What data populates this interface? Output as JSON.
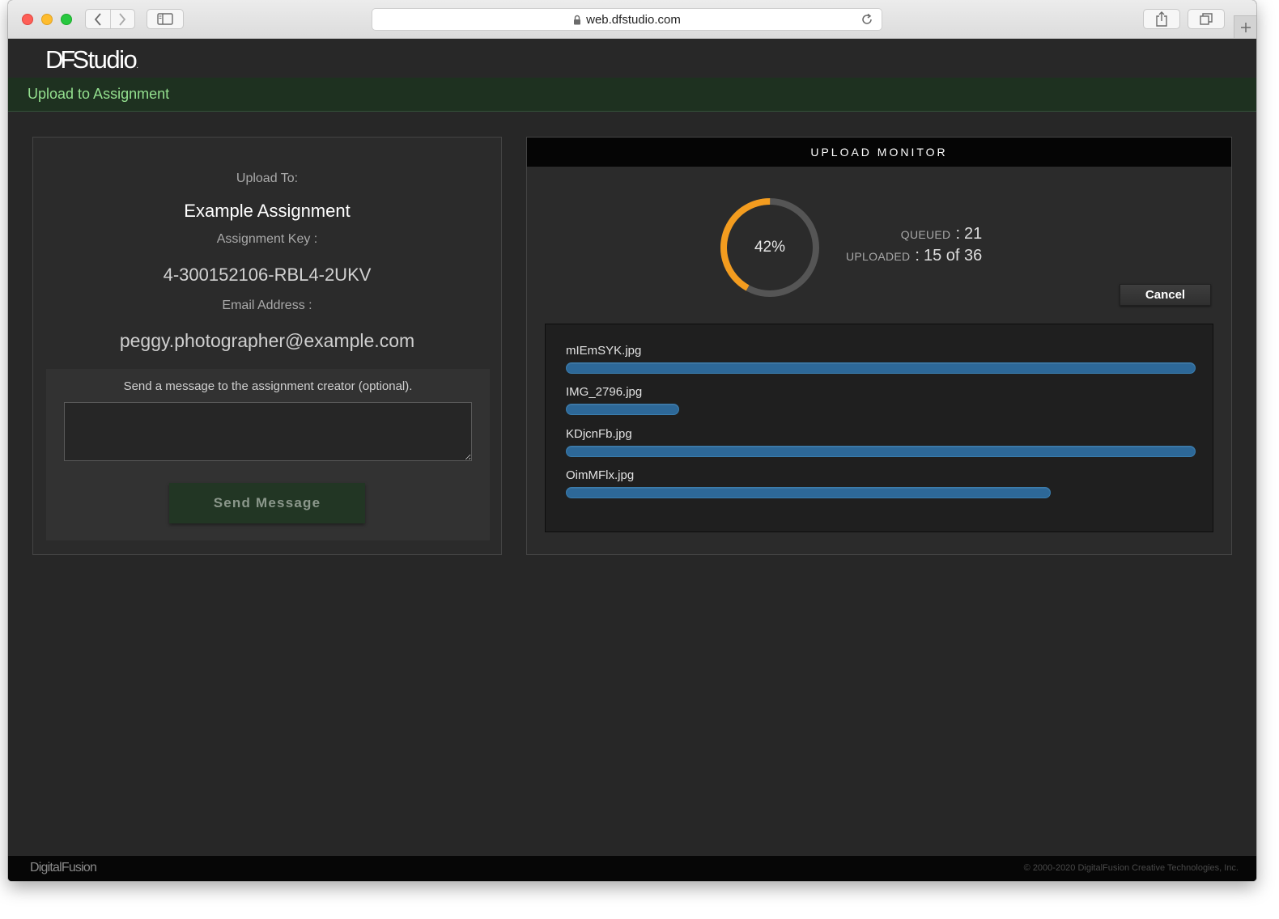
{
  "browser": {
    "url": "web.dfstudio.com"
  },
  "app": {
    "logo_prefix": "DF",
    "logo_name": "Studio",
    "logo_mark": ".",
    "page_title": "Upload to Assignment"
  },
  "upload_info": {
    "upload_to_label": "Upload To:",
    "assignment_name": "Example Assignment",
    "assignment_key_label": "Assignment Key :",
    "assignment_key": "4-300152106-RBL4-2UKV",
    "email_label": "Email Address :",
    "email": "peggy.photographer@example.com",
    "message_prompt": "Send a message to the assignment creator (optional).",
    "message_value": "",
    "send_button": "Send Message"
  },
  "monitor": {
    "title": "UPLOAD MONITOR",
    "progress_percent": 42,
    "progress_text": "42%",
    "queued_label": "QUEUED",
    "queued_value": "21",
    "uploaded_label": "UPLOADED",
    "uploaded_value": "15 of 36",
    "separator": ":",
    "cancel_button": "Cancel",
    "files": [
      {
        "name": "mIEmSYK.jpg",
        "progress": 1.0
      },
      {
        "name": "IMG_2796.jpg",
        "progress": 0.18
      },
      {
        "name": "KDjcnFb.jpg",
        "progress": 1.0
      },
      {
        "name": "OimMFlx.jpg",
        "progress": 0.77
      }
    ]
  },
  "footer": {
    "brand": "DigitalFusion",
    "copyright": "© 2000-2020 DigitalFusion Creative Technologies, Inc."
  },
  "colors": {
    "accent_green": "#94e08f",
    "ring_progress": "#f39c1f",
    "ring_track": "#555555",
    "bar_fill": "#2d6898"
  }
}
